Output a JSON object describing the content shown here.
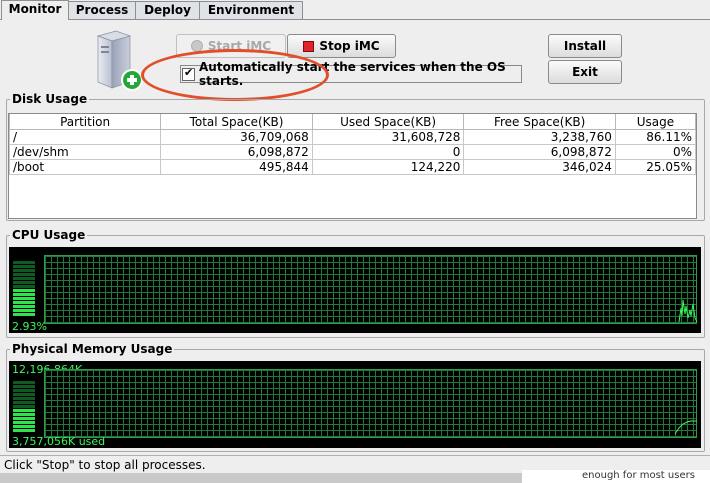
{
  "tabs": [
    "Monitor",
    "Process",
    "Deploy",
    "Environment"
  ],
  "toolbar": {
    "start_label": "Start iMC",
    "stop_label": "Stop iMC",
    "install_label": "Install",
    "exit_label": "Exit",
    "autostart_label": "Automatically start the services when the OS starts.",
    "autostart_checked": true
  },
  "disk": {
    "title": "Disk Usage",
    "columns": [
      "Partition",
      "Total Space(KB)",
      "Used Space(KB)",
      "Free Space(KB)",
      "Usage"
    ],
    "rows": [
      [
        "/",
        "36,709,068",
        "31,608,728",
        "3,238,760",
        "86.11%"
      ],
      [
        "/dev/shm",
        "6,098,872",
        "0",
        "6,098,872",
        "0%"
      ],
      [
        "/boot",
        "495,844",
        "124,220",
        "346,024",
        "25.05%"
      ]
    ]
  },
  "cpu": {
    "title": "CPU Usage",
    "usage_label": "2.93%",
    "usage_fraction": 0.0293
  },
  "memory": {
    "title": "Physical Memory Usage",
    "total_label": "12,196,864K",
    "used_label": "3,757,056K used",
    "usage_fraction": 0.308
  },
  "status": "Click \"Stop\" to stop all processes.",
  "background_text": "enough for most users"
}
